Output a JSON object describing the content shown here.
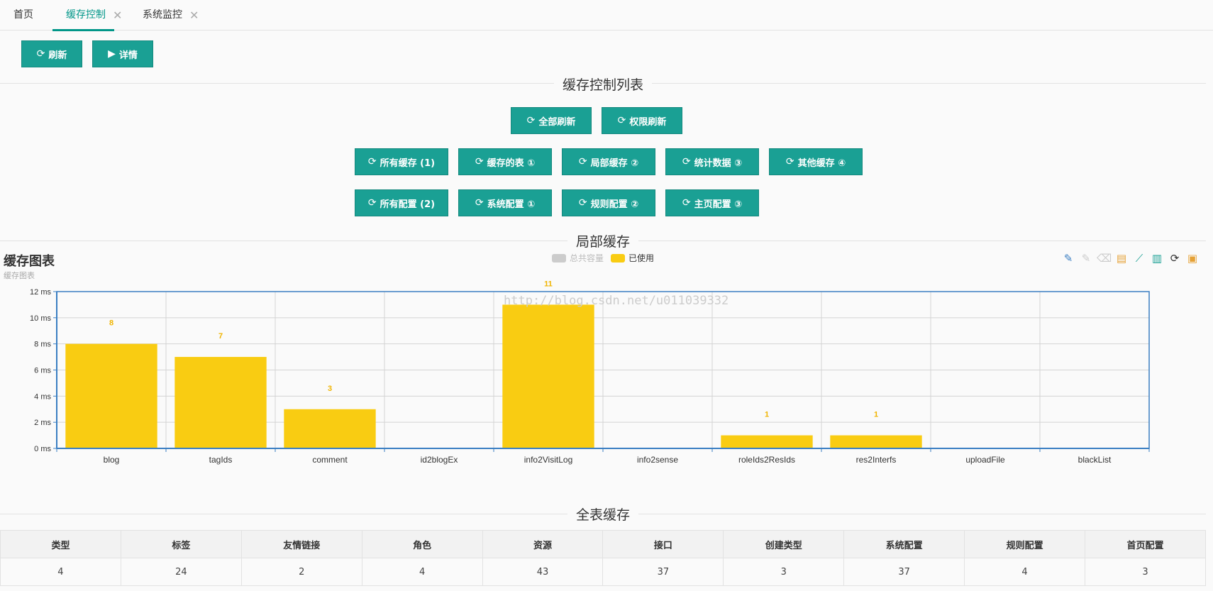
{
  "tabs": [
    {
      "label": "首页"
    },
    {
      "label": "缓存控制",
      "close": "✕"
    },
    {
      "label": "系统监控",
      "close": "✕"
    }
  ],
  "toolbar": {
    "refresh_label": "刷新",
    "details_label": "详情"
  },
  "cache_control": {
    "title": "缓存控制列表",
    "row1": [
      "全部刷新",
      "权限刷新"
    ],
    "row2": [
      "所有缓存 (1)",
      "缓存的表 ①",
      "局部缓存 ②",
      "统计数据 ③",
      "其他缓存 ④"
    ],
    "row3": [
      "所有配置 (2)",
      "系统配置 ①",
      "规则配置 ②",
      "主页配置 ③"
    ]
  },
  "partial_cache": {
    "title": "局部缓存",
    "chart_title": "缓存图表",
    "chart_subtitle": "缓存图表",
    "legend": [
      "总共容量",
      "已使用"
    ],
    "watermark": "http://blog.csdn.net/u011039332"
  },
  "chart_data": {
    "type": "bar",
    "categories": [
      "blog",
      "tagIds",
      "comment",
      "id2blogEx",
      "info2VisitLog",
      "info2sense",
      "roleIds2ResIds",
      "res2Interfs",
      "uploadFile",
      "blackList"
    ],
    "series": [
      {
        "name": "总共容量",
        "values": [
          0,
          0,
          0,
          0,
          0,
          0,
          0,
          0,
          0,
          0
        ]
      },
      {
        "name": "已使用",
        "values": [
          8,
          7,
          3,
          null,
          11,
          null,
          1,
          1,
          null,
          null
        ]
      }
    ],
    "y_ticks": [
      "0 ms",
      "2 ms",
      "4 ms",
      "6 ms",
      "8 ms",
      "10 ms",
      "12 ms"
    ],
    "ylim": [
      0,
      12
    ],
    "grid": true,
    "legend_position": "top-center"
  },
  "colors": {
    "accent": "#1aa094",
    "used": "#f9cc12",
    "total": "#cccccc",
    "axis": "#3a7ec2"
  },
  "full_table": {
    "title": "全表缓存",
    "headers": [
      "类型",
      "标签",
      "友情链接",
      "角色",
      "资源",
      "接口",
      "创建类型",
      "系统配置",
      "规则配置",
      "首页配置"
    ],
    "values": [
      "4",
      "24",
      "2",
      "4",
      "43",
      "37",
      "3",
      "37",
      "4",
      "3"
    ]
  }
}
